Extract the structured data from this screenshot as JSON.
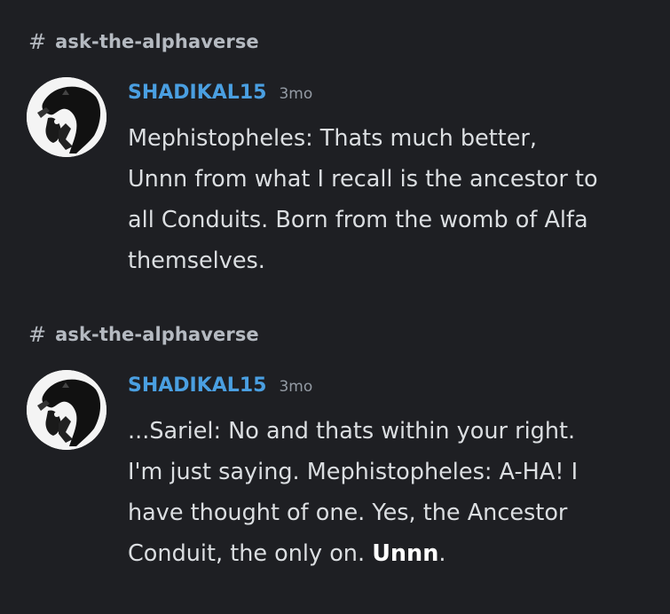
{
  "results": [
    {
      "channel": "ask-the-alphaverse",
      "author": {
        "name": "SHADIKAL15",
        "name_color": "#4a9fe1"
      },
      "timestamp": "3mo",
      "message": {
        "line1": "Mephistopheles: Thats much better,",
        "line2": "Unnn from what I recall is the ancestor to",
        "line3": "all Conduits. Born from the womb of Alfa",
        "line4": "themselves."
      }
    },
    {
      "channel": "ask-the-alphaverse",
      "author": {
        "name": "SHADIKAL15",
        "name_color": "#4a9fe1"
      },
      "timestamp": "3mo",
      "message": {
        "line1": "...Sariel: No and thats within your right.",
        "line2": "I'm just saying.  Mephistopheles: A-HA! I",
        "line3": "have thought of one. Yes, the Ancestor",
        "line4_prefix": "Conduit, the only on. ",
        "line4_bold": "Unnn",
        "line4_suffix": "."
      }
    }
  ],
  "icons": {
    "channel": "hash-icon",
    "avatar": "avatar-image"
  },
  "colors": {
    "background": "#1e1f23",
    "username": "#4a9fe1",
    "text": "#dbdee1",
    "muted": "#949ba4"
  }
}
